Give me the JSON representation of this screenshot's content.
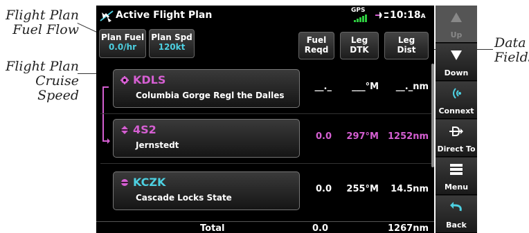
{
  "callouts": {
    "fuel_flow_line1": "Flight Plan",
    "fuel_flow_line2": "Fuel Flow",
    "cruise_line1": "Flight Plan",
    "cruise_line2": "Cruise Speed",
    "data_line1": "Data",
    "data_line2": "Fields"
  },
  "titlebar": {
    "title": "Active Flight Plan",
    "gps_label": "GPS",
    "time": "10:18",
    "time_suffix": "A"
  },
  "header_buttons": {
    "plan_fuel_label": "Plan Fuel",
    "plan_fuel_value": "0.0/hr",
    "plan_spd_label": "Plan Spd",
    "plan_spd_value": "120kt",
    "fuel_reqd_line1": "Fuel",
    "fuel_reqd_line2": "Reqd",
    "leg_dtk_line1": "Leg",
    "leg_dtk_line2": "DTK",
    "leg_dist_line1": "Leg",
    "leg_dist_line2": "Dist"
  },
  "waypoints": [
    {
      "id": "KDLS",
      "name": "Columbia Gorge Regl the Dalles",
      "fuel": "__._",
      "dtk": "___°M",
      "dist": "__._nm",
      "color": "#d55fd2"
    },
    {
      "id": "4S2",
      "name": "Jernstedt",
      "fuel": "0.0",
      "dtk": "297°M",
      "dist": "1252nm",
      "color": "#d55fd2"
    },
    {
      "id": "KCZK",
      "name": "Cascade Locks State",
      "fuel": "0.0",
      "dtk": "255°M",
      "dist": "14.5nm",
      "color": "#ffffff"
    }
  ],
  "waypoint_id_colors": [
    "#d55fd2",
    "#d55fd2",
    "#4dd0e1"
  ],
  "total": {
    "label": "Total",
    "fuel": "0.0",
    "dist": "1267nm"
  },
  "sidebar": {
    "up": "Up",
    "down": "Down",
    "connext": "Connext",
    "direct_to": "Direct To",
    "menu": "Menu",
    "back": "Back"
  },
  "colors": {
    "magenta": "#d55fd2",
    "cyan": "#4dd0e1",
    "background": "#000000"
  }
}
